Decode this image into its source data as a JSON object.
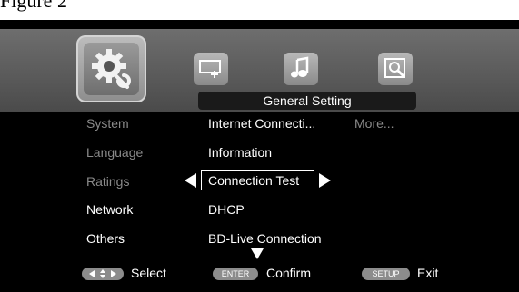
{
  "caption": "Figure 2",
  "header": {
    "title": "General Setting",
    "icons": [
      "settings-gear-wrench-icon",
      "display-setup-icon",
      "audio-note-icon",
      "language-book-icon"
    ]
  },
  "categories": {
    "items": [
      {
        "label": "System",
        "active": false
      },
      {
        "label": "Language",
        "active": false
      },
      {
        "label": "Ratings",
        "active": false
      },
      {
        "label": "Network",
        "active": true
      },
      {
        "label": "Others",
        "active": true
      }
    ]
  },
  "options": {
    "items": [
      "Internet Connecti...",
      "Information",
      "Connection Test",
      "DHCP",
      "BD-Live Connection"
    ],
    "more": "More...",
    "selected_index": 2
  },
  "footer": {
    "nav_hint": "Select",
    "enter_key": "ENTER",
    "enter_label": "Confirm",
    "setup_key": "SETUP",
    "setup_label": "Exit"
  },
  "colors": {
    "background": "#000000",
    "band": "#5a5a5a",
    "highlight": "#ffffff",
    "dim_text": "#8a8a8a"
  }
}
